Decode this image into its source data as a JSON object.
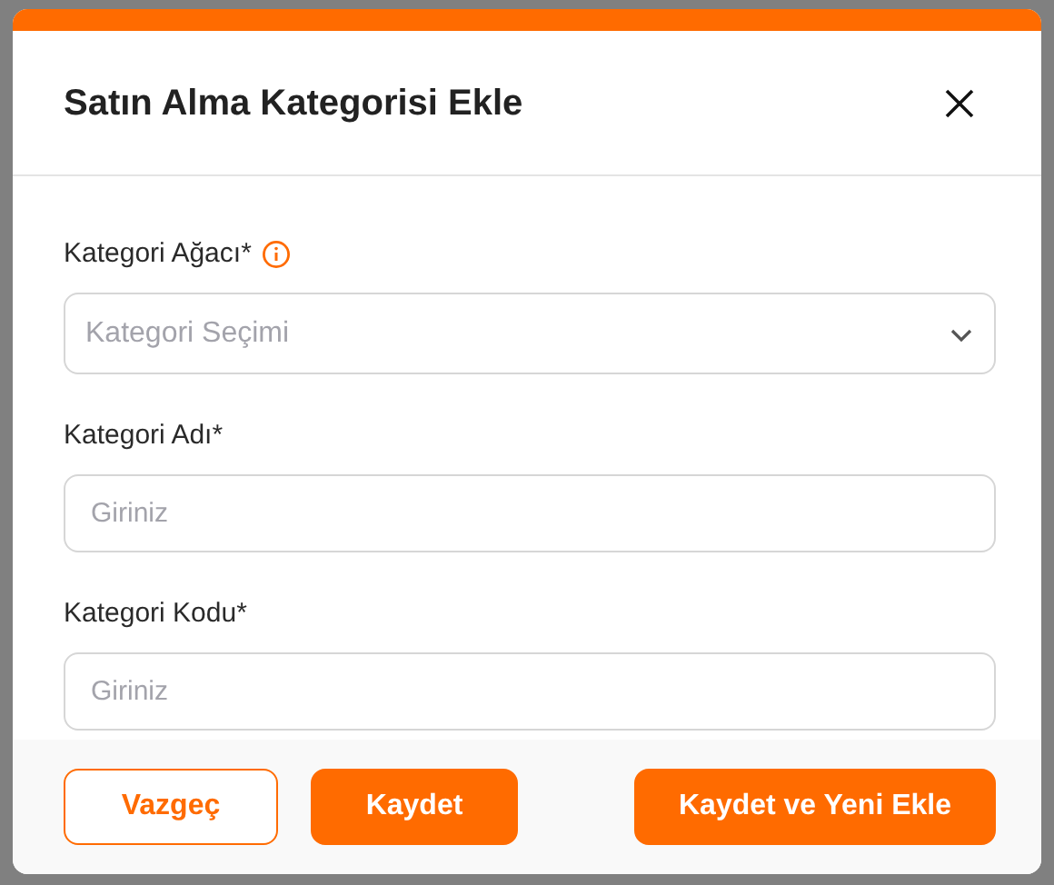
{
  "dialog": {
    "title": "Satın Alma Kategorisi Ekle"
  },
  "fields": [
    {
      "kind": "select",
      "label": "Kategori Ağacı*",
      "info": true,
      "placeholder": "Kategori Seçimi"
    },
    {
      "kind": "text",
      "label": "Kategori Adı*",
      "info": false,
      "placeholder": "Giriniz"
    },
    {
      "kind": "text",
      "label": "Kategori Kodu*",
      "info": false,
      "placeholder": "Giriniz"
    }
  ],
  "buttons": [
    {
      "label": "Vazgeç",
      "kind": "outline"
    },
    {
      "label": "Kaydet",
      "kind": "primary"
    },
    {
      "label": "Kaydet ve Yeni Ekle",
      "kind": "primary"
    }
  ]
}
